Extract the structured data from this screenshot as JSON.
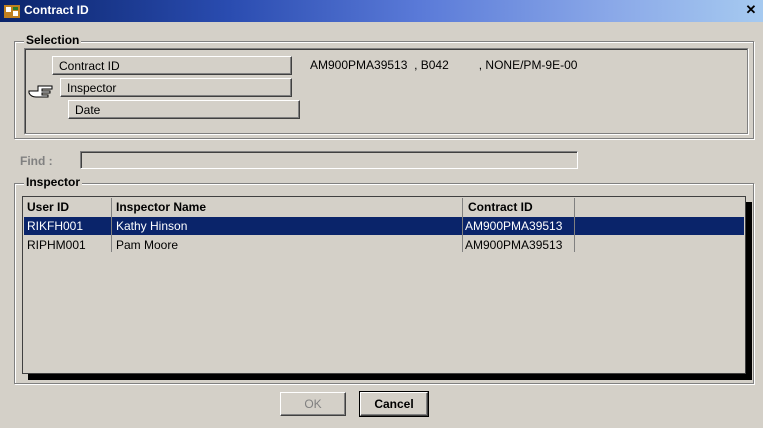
{
  "window": {
    "title": "Contract ID",
    "close_glyph": "✕"
  },
  "selection": {
    "label": "Selection",
    "tabs": [
      {
        "label": "Contract ID"
      },
      {
        "label": "Inspector"
      },
      {
        "label": "Date"
      }
    ],
    "contract_value": "AM900PMA39513  , B042         , NONE/PM-9E-00"
  },
  "find": {
    "label": "Find :",
    "value": ""
  },
  "inspector": {
    "label": "Inspector",
    "columns": [
      "User ID",
      "Inspector Name",
      "Contract ID"
    ],
    "rows": [
      {
        "user_id": "RIKFH001",
        "name": "Kathy Hinson",
        "contract_id": "AM900PMA39513",
        "selected": true
      },
      {
        "user_id": "RIPHM001",
        "name": "Pam Moore",
        "contract_id": "AM900PMA39513",
        "selected": false
      }
    ]
  },
  "buttons": {
    "ok_label": "OK",
    "cancel_label": "Cancel"
  },
  "colors": {
    "selection_highlight": "#0a246a",
    "dialog_bg": "#d4d0c8"
  }
}
